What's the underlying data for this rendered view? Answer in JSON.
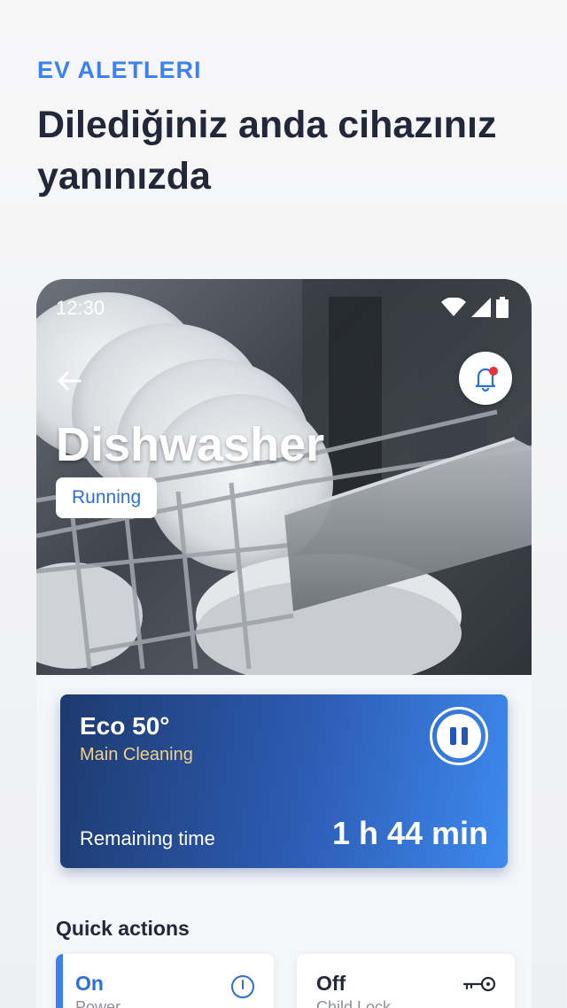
{
  "intro": {
    "eyebrow": "EV ALETLERI",
    "headline": "Dilediğiniz anda cihazınız yanınızda"
  },
  "status_bar": {
    "time": "12:30"
  },
  "appliance": {
    "title": "Dishwasher",
    "status": "Running"
  },
  "program": {
    "name": "Eco 50°",
    "phase": "Main Cleaning",
    "remaining_label": "Remaining time",
    "remaining_value": "1 h 44 min"
  },
  "quick_actions": {
    "title": "Quick actions",
    "items": [
      {
        "value": "On",
        "label": "Power",
        "icon": "power-icon"
      },
      {
        "value": "Off",
        "label": "Child Lock",
        "icon": "key-icon"
      }
    ]
  },
  "colors": {
    "accent": "#3b82f0",
    "headline": "#22283a",
    "phase": "#f2d08a",
    "notification_dot": "#e8303a"
  }
}
